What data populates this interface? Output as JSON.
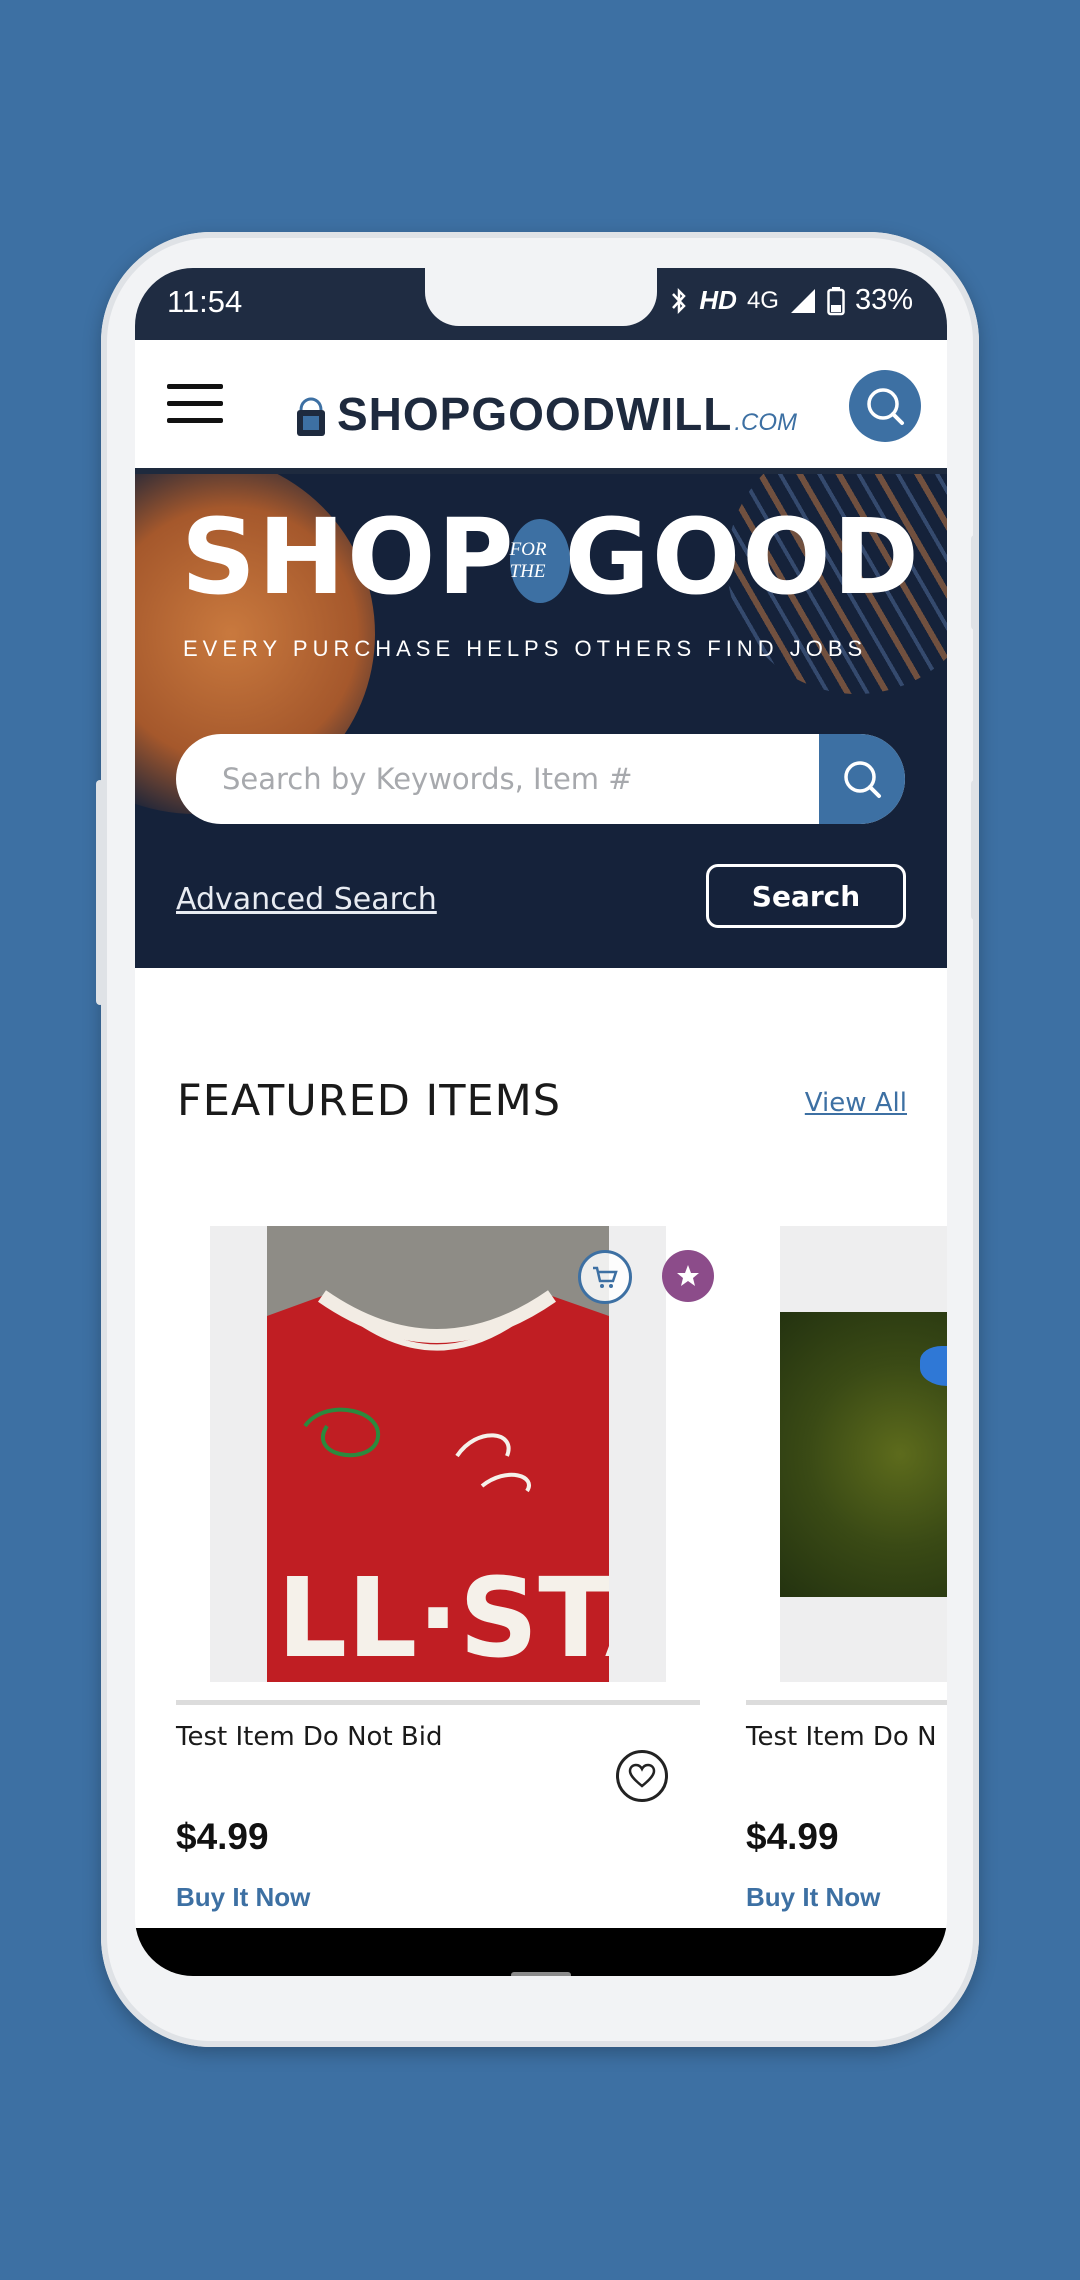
{
  "status_bar": {
    "time": "11:54",
    "hd": "HD",
    "network": "4G",
    "battery": "33%"
  },
  "header": {
    "logo_text": "SHOPGOODWILL",
    "logo_suffix": ".COM"
  },
  "hero": {
    "title_left": "SHOP",
    "title_badge": "FOR THE",
    "title_right": "GOOD",
    "subtitle": "EVERY PURCHASE HELPS OTHERS FIND JOBS",
    "search_placeholder": "Search by Keywords, Item #",
    "advanced_search_label": "Advanced Search",
    "search_button_label": "Search"
  },
  "featured": {
    "title": "FEATURED ITEMS",
    "view_all_label": "View All",
    "items": [
      {
        "name": "Test Item Do Not Bid",
        "price": "$4.99",
        "buy_label": "Buy It Now"
      },
      {
        "name": "Test Item Do N",
        "price": "$4.99",
        "buy_label": "Buy It Now"
      }
    ]
  },
  "icons": {
    "menu": "hamburger-menu-icon",
    "search": "search-icon",
    "cart": "cart-icon",
    "star": "star-icon",
    "heart": "heart-icon",
    "bluetooth": "bluetooth-icon",
    "signal": "signal-icon",
    "battery": "battery-icon"
  },
  "colors": {
    "brand_blue": "#3d70a3",
    "navy": "#1e2a3e",
    "hero_bg": "#15223a",
    "star_badge": "#8c4c8a"
  }
}
